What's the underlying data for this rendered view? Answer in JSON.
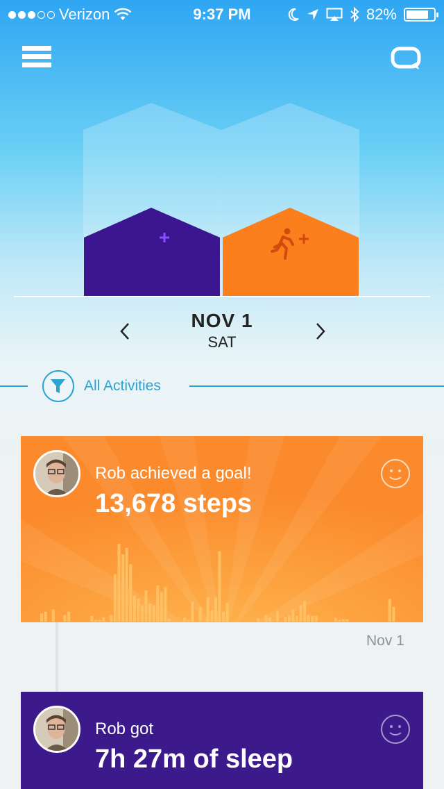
{
  "status_bar": {
    "carrier": "Verizon",
    "time": "9:37 PM",
    "battery": "82%",
    "battery_level": 0.82,
    "icons": [
      "signal-dots-icon",
      "wifi-icon",
      "moon-icon",
      "location-icon",
      "airplay-icon",
      "bluetooth-icon",
      "battery-icon"
    ]
  },
  "header": {
    "menu_icon": "hamburger-menu-icon",
    "chat_icon": "chat-bubble-icon"
  },
  "goals": {
    "sleep": {
      "color": "#3b1690",
      "ghost_color": "#d8f0fa",
      "icon": "moon-plus-icon",
      "accent": "#8a4fff"
    },
    "activity": {
      "color": "#fb7f1c",
      "ghost_color": "#d8f0fa",
      "icon": "runner-plus-icon",
      "accent": "#d24a0e"
    }
  },
  "date_nav": {
    "date": "NOV 1",
    "weekday": "SAT",
    "prev_icon": "chevron-left-icon",
    "next_icon": "chevron-right-icon"
  },
  "filter": {
    "label": "All Activities",
    "icon": "filter-funnel-icon",
    "color": "#29a3d4"
  },
  "feed": [
    {
      "type": "steps",
      "subtitle": "Rob achieved a goal!",
      "headline": "13,678 steps",
      "reaction_icon": "smiley-icon",
      "bar_values": [
        0.1,
        0.12,
        0,
        0.15,
        0,
        0,
        0.08,
        0.12,
        0,
        0,
        0,
        0,
        0,
        0.07,
        0.02,
        0.02,
        0.05,
        0,
        0.08,
        0.58,
        0.95,
        0.82,
        0.9,
        0.7,
        0.32,
        0.28,
        0.2,
        0.38,
        0.22,
        0.2,
        0.44,
        0.36,
        0.42,
        0.04,
        0,
        0,
        0,
        0.05,
        0.02,
        0.24,
        0,
        0.18,
        0,
        0.3,
        0.14,
        0.3,
        0.86,
        0.12,
        0.23,
        0,
        0,
        0,
        0,
        0,
        0,
        0,
        0.04,
        0,
        0.08,
        0.05,
        0,
        0.12,
        0,
        0.06,
        0.08,
        0.15,
        0.07,
        0.2,
        0.25,
        0.08,
        0.07,
        0.07,
        0,
        0,
        0,
        0,
        0.05,
        0.02,
        0.03,
        0.03,
        0,
        0,
        0,
        0,
        0,
        0,
        0,
        0,
        0,
        0,
        0.28,
        0.18,
        0,
        0
      ]
    },
    {
      "type": "sleep",
      "subtitle": "Rob got",
      "headline": "7h 27m of sleep",
      "reaction_icon": "smiley-icon"
    }
  ],
  "feed_date": "Nov 1"
}
